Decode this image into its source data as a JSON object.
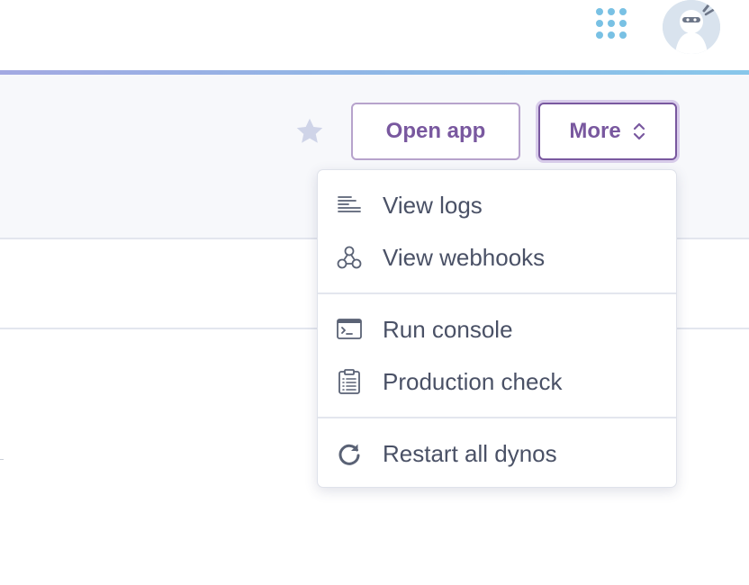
{
  "topbar": {
    "apps_icon": "apps-grid-icon",
    "avatar_icon": "user-avatar-icon"
  },
  "header": {
    "favorite_icon": "star-icon",
    "open_app_label": "Open app",
    "more_label": "More",
    "more_icon": "chevron-up-down-icon"
  },
  "menu": {
    "groups": [
      {
        "items": [
          {
            "label": "View logs",
            "icon": "logs-icon"
          },
          {
            "label": "View webhooks",
            "icon": "webhooks-icon"
          }
        ]
      },
      {
        "items": [
          {
            "label": "Run console",
            "icon": "console-icon"
          },
          {
            "label": "Production check",
            "icon": "clipboard-checklist-icon"
          }
        ]
      },
      {
        "items": [
          {
            "label": "Restart all dynos",
            "icon": "restart-icon"
          }
        ]
      }
    ]
  },
  "colors": {
    "brand_purple": "#79589f",
    "accent_blue": "#79c1e4",
    "menu_text": "#4a5166"
  }
}
